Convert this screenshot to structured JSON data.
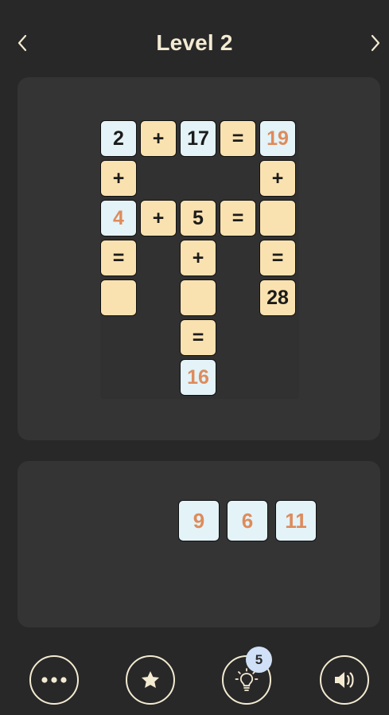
{
  "header": {
    "title": "Level 2",
    "prev_icon": "chevron-left-icon",
    "next_icon": "chevron-right-icon"
  },
  "board": {
    "cells": [
      {
        "row": 0,
        "col": 0,
        "text": "2",
        "kind": "number",
        "given": true
      },
      {
        "row": 0,
        "col": 1,
        "text": "+",
        "kind": "operator"
      },
      {
        "row": 0,
        "col": 2,
        "text": "17",
        "kind": "number",
        "given": true
      },
      {
        "row": 0,
        "col": 3,
        "text": "=",
        "kind": "operator"
      },
      {
        "row": 0,
        "col": 4,
        "text": "19",
        "kind": "number",
        "placed": true
      },
      {
        "row": 1,
        "col": 0,
        "text": "+",
        "kind": "operator"
      },
      {
        "row": 1,
        "col": 4,
        "text": "+",
        "kind": "operator"
      },
      {
        "row": 2,
        "col": 0,
        "text": "4",
        "kind": "number",
        "placed": true
      },
      {
        "row": 2,
        "col": 1,
        "text": "+",
        "kind": "operator"
      },
      {
        "row": 2,
        "col": 2,
        "text": "5",
        "kind": "number",
        "given": true,
        "style": "fill"
      },
      {
        "row": 2,
        "col": 3,
        "text": "=",
        "kind": "operator"
      },
      {
        "row": 2,
        "col": 4,
        "text": "",
        "kind": "empty"
      },
      {
        "row": 3,
        "col": 0,
        "text": "=",
        "kind": "operator"
      },
      {
        "row": 3,
        "col": 2,
        "text": "+",
        "kind": "operator"
      },
      {
        "row": 3,
        "col": 4,
        "text": "=",
        "kind": "operator"
      },
      {
        "row": 4,
        "col": 0,
        "text": "",
        "kind": "empty"
      },
      {
        "row": 4,
        "col": 2,
        "text": "",
        "kind": "empty"
      },
      {
        "row": 4,
        "col": 4,
        "text": "28",
        "kind": "number",
        "given": true,
        "style": "fill"
      },
      {
        "row": 5,
        "col": 2,
        "text": "=",
        "kind": "operator"
      },
      {
        "row": 6,
        "col": 2,
        "text": "16",
        "kind": "number",
        "placed": true
      }
    ]
  },
  "tray": {
    "tiles": [
      "9",
      "6",
      "11"
    ]
  },
  "toolbar": {
    "buttons": [
      {
        "name": "more-button",
        "icon": "ellipsis-icon"
      },
      {
        "name": "star-button",
        "icon": "star-icon"
      },
      {
        "name": "hint-button",
        "icon": "lightbulb-icon"
      },
      {
        "name": "sound-button",
        "icon": "speaker-icon"
      }
    ],
    "hint_count": "5"
  },
  "colors": {
    "background": "#282828",
    "panel": "#343434",
    "accent_text": "#f3ead2",
    "number_tile": "#e3f3f8",
    "operator_tile": "#fae2b0",
    "placed_number": "#de8b5b",
    "badge": "#cfe0f7"
  }
}
